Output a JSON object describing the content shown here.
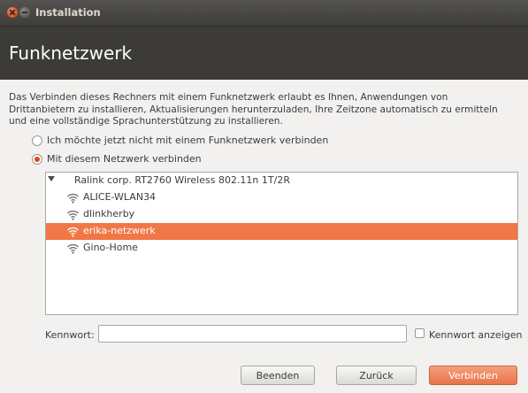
{
  "window": {
    "title": "Installation"
  },
  "header": {
    "title": "Funknetzwerk"
  },
  "intro": {
    "line1": "Das Verbinden dieses Rechners mit einem Funknetzwerk erlaubt es Ihnen, Anwendungen von",
    "line2": "Drittanbietern zu installieren, Aktualisierungen herunterzuladen, Ihre Zeitzone automatisch zu ermitteln",
    "line3": "und eine vollständige Sprachunterstützung zu installieren."
  },
  "options": {
    "no_network": {
      "label": "Ich möchte jetzt nicht mit einem Funknetzwerk verbinden",
      "checked": false
    },
    "this_network": {
      "label": "Mit diesem Netzwerk verbinden",
      "checked": true
    }
  },
  "network_list": {
    "device": "Ralink corp. RT2760 Wireless 802.11n 1T/2R",
    "networks": [
      {
        "name": "ALICE-WLAN34",
        "selected": false,
        "icon": "wifi-icon"
      },
      {
        "name": "dlinkherby",
        "selected": false,
        "icon": "wifi-icon"
      },
      {
        "name": "erika-netzwerk",
        "selected": true,
        "icon": "wifi-icon"
      },
      {
        "name": "Gino-Home",
        "selected": false,
        "icon": "wifi-icon"
      }
    ]
  },
  "password": {
    "label": "Kennwort:",
    "value": "",
    "show_label": "Kennwort anzeigen",
    "show_checked": false
  },
  "buttons": {
    "quit": "Beenden",
    "back": "Zurück",
    "connect": "Verbinden"
  },
  "colors": {
    "accent": "#dd4814",
    "selection": "#f07746",
    "header_bg": "#3c3b37"
  }
}
